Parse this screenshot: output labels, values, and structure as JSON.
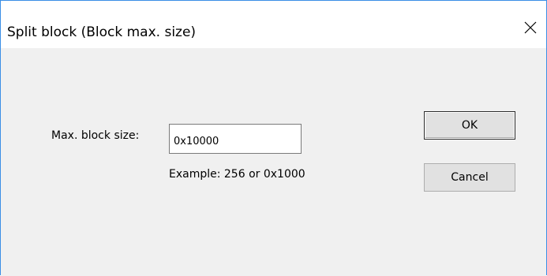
{
  "dialog": {
    "title": "Split block (Block max. size)",
    "close_icon": "close-icon"
  },
  "form": {
    "max_block_size_label": "Max. block size:",
    "max_block_size_value": "0x10000",
    "example_text": "Example:  256 or 0x1000"
  },
  "buttons": {
    "ok_label": "OK",
    "cancel_label": "Cancel"
  },
  "colors": {
    "window_border": "#3a8ee6",
    "title_bar": "#ffffff",
    "client_background": "#f0f0f0",
    "button_face": "#e1e1e1"
  }
}
